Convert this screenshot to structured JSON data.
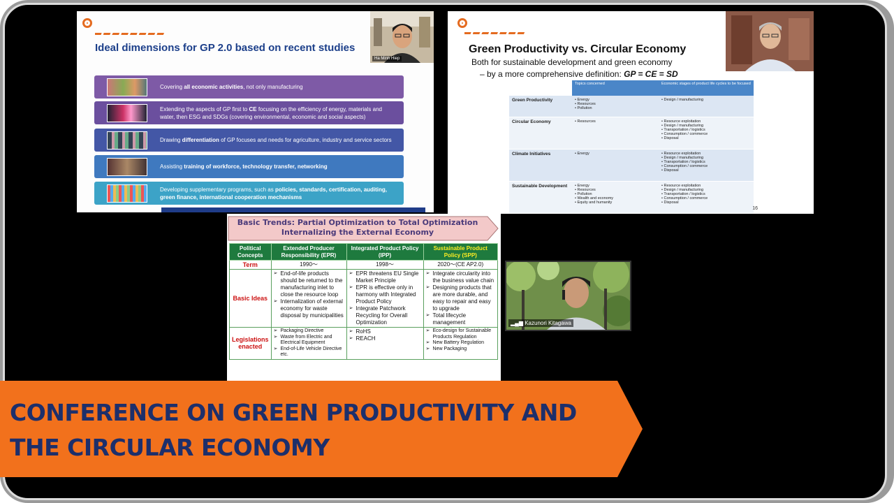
{
  "banner": {
    "line1": "CONFERENCE ON GREEN PRODUCTIVITY AND",
    "line2": "THE CIRCULAR ECONOMY",
    "color": "#f2711c",
    "text_color": "#1d2f6b"
  },
  "slide1": {
    "title": "Ideal dimensions for GP 2.0 based on recent studies",
    "speaker": "Ha Minh Hiep",
    "items": [
      {
        "pre": "Covering ",
        "bold": "all economic activities",
        "post": ", not only manufacturing",
        "color": "#7e5aa6"
      },
      {
        "pre": "Extending the aspects of GP first to ",
        "bold": "CE",
        "post": " focusing on the efficiency of energy, materials and water, then ESG and SDGs (covering environmental, economic and social aspects)",
        "color": "#6b4f9e"
      },
      {
        "pre": "Drawing ",
        "bold": "differentiation",
        "post": " of GP focuses and needs for agriculture, industry and service sectors",
        "color": "#4357a6"
      },
      {
        "pre": "Assisting ",
        "bold": "training of workforce, technology transfer, networking",
        "post": "",
        "color": "#3f79bf"
      },
      {
        "pre": "Developing supplementary programs, such as ",
        "bold": "policies, standards, certification, auditing, green finance, international cooperation mechanisms",
        "post": "",
        "color": "#3ca3c7"
      }
    ]
  },
  "slide2": {
    "title": "Green Productivity vs. Circular Economy",
    "subtitle": "Both for sustainable development and green economy",
    "definition_prefix": "– by a more comprehensive definition: ",
    "definition": "GP = CE = SD",
    "header": [
      "",
      "Topics concerned",
      "Economic stages of product life cycles to be focused"
    ],
    "rows": [
      {
        "name": "Green Productivity",
        "topics": [
          "Energy",
          "Resources",
          "Pollution"
        ],
        "stages": [
          "Design / manufacturing"
        ]
      },
      {
        "name": "Circular Economy",
        "topics": [
          "Resources"
        ],
        "stages": [
          "Resource exploitation",
          "Design / manufacturing",
          "Transportation / logistics",
          "Consumption / commerce",
          "Disposal"
        ]
      },
      {
        "name": "Climate Initiatives",
        "topics": [
          "Energy"
        ],
        "stages": [
          "Resource exploitation",
          "Design / manufacturing",
          "Transportation / logistics",
          "Consumption / commerce",
          "Disposal"
        ]
      },
      {
        "name": "Sustainable Development",
        "topics": [
          "Energy",
          "Resources",
          "Pollution",
          "Wealth and economy",
          "Equity and humanity"
        ],
        "stages": [
          "Resource exploitation",
          "Design / manufacturing",
          "Transportation / logistics",
          "Consumption / commerce",
          "Disposal"
        ]
      }
    ],
    "page_number": "16"
  },
  "slide3": {
    "banner_line1": "Basic Trends: Partial Optimization to Total Optimization",
    "banner_line2": "Internalizing the External Economy",
    "header": [
      "Political Concepts",
      "Extended Producer Responsibility (EPR)",
      "Integrated Product Policy (IPP)",
      "Sustainable Product Policy (SPP)"
    ],
    "term_label": "Term",
    "terms": [
      "1990～",
      "1998～",
      "2020～(CE AP2.0)"
    ],
    "ideas_label": "Basic Ideas",
    "ideas": [
      [
        "End-of-life products should be returned to the manufacturing inlet to close the resource loop",
        "Internalization of external economy for waste disposal by municipalities"
      ],
      [
        "EPR threatens EU Single Market Principle",
        "EPR is effective only in harmony with Integrated Product Policy",
        "Integrate Patchwork Recycling for Overall Optimization"
      ],
      [
        "Integrate circularity into the business value chain",
        "Designing products that are more durable, and easy to repair and easy to upgrade",
        "Total lifecycle management"
      ]
    ],
    "legislation_label": "Legislations enacted",
    "legislation": [
      [
        "Packaging Directive",
        "Waste from Electric and Electrical Equipment",
        "End-of-Life Vehicle Directive etc."
      ],
      [
        "RoHS",
        "REACH"
      ],
      [
        "Eco-design for Sustainable Products Regulation",
        "New Battery Regulation",
        "New Packaging"
      ]
    ]
  },
  "cameras": {
    "cam4_name": "Kazunori Kitagawa"
  }
}
